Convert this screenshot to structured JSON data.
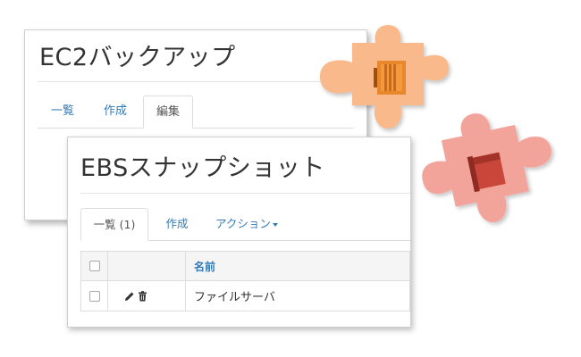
{
  "ec2_window": {
    "title": "EC2バックアップ",
    "tabs": [
      {
        "label": "一覧"
      },
      {
        "label": "作成"
      },
      {
        "label": "編集"
      }
    ]
  },
  "ebs_window": {
    "title": "EBSスナップショット",
    "tabs": [
      {
        "label": "一覧 (1)"
      },
      {
        "label": "作成"
      },
      {
        "label": "アクション"
      }
    ],
    "table": {
      "columns": [
        "",
        "",
        "名前"
      ],
      "rows": [
        {
          "name": "ファイルサーバ"
        }
      ]
    }
  },
  "icons": {
    "edit": "pencil-icon",
    "delete": "trash-icon",
    "ec2_piece": "aws-ec2-icon",
    "ebs_piece": "aws-ebs-snapshot-icon"
  },
  "colors": {
    "link": "#337ab7",
    "ec2_piece": "#f9b98a",
    "ec2_icon": "#e8872b",
    "ebs_piece": "#f2a49a",
    "ebs_icon": "#c9463a"
  }
}
